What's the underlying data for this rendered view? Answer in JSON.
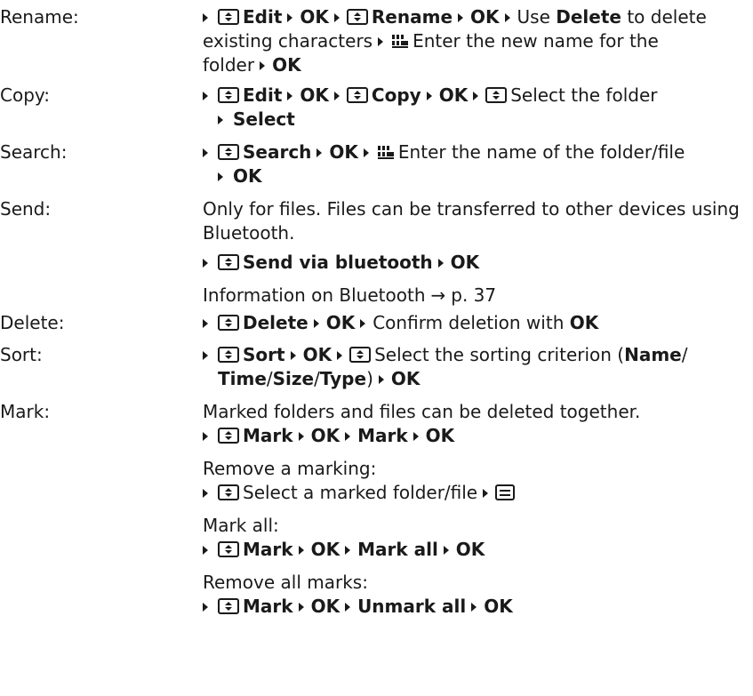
{
  "rename": {
    "term": "Rename:",
    "edit": "Edit",
    "ok1": "OK",
    "rename": "Rename",
    "ok2": "OK",
    "use": "Use",
    "delete": "Delete",
    "to_delete": "to delete",
    "existing": "existing characters",
    "enter": "Enter the new name for the",
    "folder": "folder",
    "ok3": "OK"
  },
  "copy": {
    "term": "Copy:",
    "edit": "Edit",
    "ok1": "OK",
    "copy": "Copy",
    "ok2": "OK",
    "select_folder": "Select the folder",
    "select": "Select"
  },
  "search": {
    "term": "Search:",
    "search": "Search",
    "ok1": "OK",
    "enter": "Enter the name of the folder/file",
    "ok2": "OK"
  },
  "send": {
    "term": "Send:",
    "line1": "Only for files. Files can be transferred to other devices using",
    "line2": "Bluetooth.",
    "send_via": "Send via bluetooth",
    "ok": "OK",
    "info": "Information on Bluetooth",
    "ref_arrow": "→",
    "ref_page": "p. 37"
  },
  "delete": {
    "term": "Delete:",
    "delete": "Delete",
    "ok": "OK",
    "confirm": "Confirm deletion with",
    "ok2": "OK"
  },
  "sort": {
    "term": "Sort:",
    "sort": "Sort",
    "ok1": "OK",
    "select": "Select the sorting criterion (",
    "name": "Name",
    "slash1": "/",
    "time": "Time",
    "slash2": "/",
    "size": "Size",
    "slash3": "/",
    "type": "Type",
    "close": ")",
    "ok2": "OK"
  },
  "mark": {
    "term": "Mark:",
    "intro": "Marked folders and files can be deleted together.",
    "mark1": "Mark",
    "ok1": "OK",
    "mark2": "Mark",
    "ok2": "OK",
    "remove_marking": "Remove a marking:",
    "select_marked": "Select a marked folder/file",
    "mark_all_heading": "Mark all:",
    "mark3": "Mark",
    "ok3": "OK",
    "mark_all": "Mark all",
    "ok4": "OK",
    "remove_all_heading": "Remove all marks:",
    "mark4": "Mark",
    "ok5": "OK",
    "unmark_all": "Unmark all",
    "ok6": "OK"
  },
  "icons": [
    "navigation-key-icon",
    "keypad-icon",
    "menu-key-icon",
    "arrow-bullet-icon",
    "reference-arrow-icon"
  ]
}
